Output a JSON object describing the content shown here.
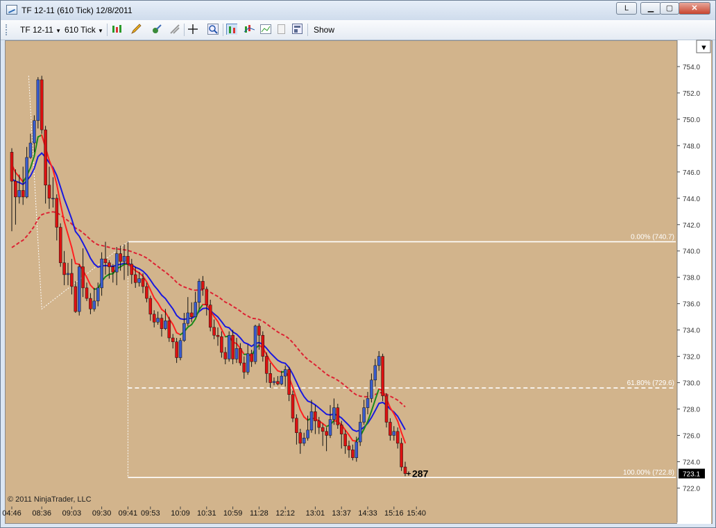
{
  "window": {
    "title": "TF 12-11 (610 Tick)  12/8/2011",
    "btn_l": "L",
    "btn_min": "▁",
    "btn_max": "▢",
    "btn_close": "✕"
  },
  "toolbar": {
    "instrument": "TF 12-11",
    "interval": "610 Tick",
    "show_label": "Show"
  },
  "copyright": "© 2011 NinjaTrader, LLC",
  "colors": {
    "background": "#d2b48c",
    "up_candle": "#3a5ccc",
    "down_candle": "#dd1111",
    "ma_fast": "#ff2020",
    "ma_fast_alt": "#1a8a1a",
    "ma_mid": "#1818e0",
    "ma_slow": "#dd2233",
    "fib": "#ffffff"
  },
  "chart_data": {
    "type": "candlestick",
    "y_range": [
      721,
      755
    ],
    "y_ticks": [
      "754.0",
      "752.0",
      "750.0",
      "748.0",
      "746.0",
      "744.0",
      "742.0",
      "740.0",
      "738.0",
      "736.0",
      "734.0",
      "732.0",
      "730.0",
      "728.0",
      "726.0",
      "724.0",
      "722.0"
    ],
    "x_ticks": [
      "04:46",
      "08:36",
      "09:03",
      "09:30",
      "09:41",
      "09:53",
      "10:09",
      "10:31",
      "10:59",
      "11:28",
      "12:12",
      "13:01",
      "13:37",
      "14:33",
      "15:16",
      "15:40"
    ],
    "x_tick_bar_index": [
      0,
      8,
      16,
      24,
      31,
      37,
      45,
      52,
      59,
      66,
      73,
      81,
      88,
      95,
      102,
      108
    ],
    "last_price_label": "723.1",
    "last_price": 723.1,
    "bar_counter": "287",
    "fibonacci": [
      {
        "label": "0.00% (740.7)",
        "value": 740.7
      },
      {
        "label": "61.80% (729.6)",
        "value": 729.6
      },
      {
        "label": "100.00% (722.8)",
        "value": 722.8
      }
    ],
    "candles": [
      [
        747.5,
        745.3,
        747.8,
        741.5
      ],
      [
        745.3,
        744.1,
        746.2,
        742.0
      ],
      [
        744.1,
        744.6,
        745.8,
        743.6
      ],
      [
        744.6,
        744.1,
        746.4,
        743.5
      ],
      [
        744.1,
        747.1,
        747.9,
        744.0
      ],
      [
        747.1,
        748.2,
        748.9,
        747.0
      ],
      [
        748.2,
        749.9,
        750.3,
        747.5
      ],
      [
        749.9,
        753.0,
        753.2,
        749.3
      ],
      [
        753.0,
        749.2,
        753.3,
        748.9
      ],
      [
        749.2,
        745.0,
        749.5,
        743.6
      ],
      [
        745.0,
        744.0,
        746.4,
        743.2
      ],
      [
        744.0,
        744.0,
        745.6,
        743.3
      ],
      [
        744.0,
        741.8,
        744.3,
        740.8
      ],
      [
        741.8,
        739.1,
        742.1,
        738.8
      ],
      [
        739.1,
        738.2,
        740.0,
        737.4
      ],
      [
        738.2,
        738.3,
        739.1,
        737.4
      ],
      [
        738.3,
        737.3,
        739.4,
        736.7
      ],
      [
        737.3,
        735.4,
        737.7,
        735.3
      ],
      [
        735.4,
        738.8,
        739.0,
        735.1
      ],
      [
        738.8,
        737.2,
        740.2,
        736.5
      ],
      [
        737.2,
        736.4,
        737.6,
        736.2
      ],
      [
        736.4,
        735.6,
        736.8,
        735.2
      ],
      [
        735.6,
        736.2,
        737.2,
        735.4
      ],
      [
        736.2,
        737.2,
        737.6,
        735.8
      ],
      [
        737.2,
        739.4,
        739.9,
        736.6
      ],
      [
        739.4,
        739.1,
        740.7,
        738.2
      ],
      [
        739.1,
        738.8,
        739.3,
        737.9
      ],
      [
        738.8,
        738.4,
        739.0,
        737.6
      ],
      [
        738.4,
        739.8,
        740.3,
        737.4
      ],
      [
        739.8,
        739.2,
        740.4,
        738.5
      ],
      [
        739.2,
        739.6,
        740.5,
        737.8
      ],
      [
        739.6,
        739.0,
        740.7,
        738.1
      ],
      [
        739.0,
        738.2,
        739.4,
        737.5
      ],
      [
        738.2,
        737.6,
        738.8,
        737.2
      ],
      [
        737.6,
        737.9,
        738.4,
        737.3
      ],
      [
        737.9,
        737.3,
        738.3,
        736.8
      ],
      [
        737.3,
        736.4,
        737.6,
        736.1
      ],
      [
        736.4,
        735.2,
        736.6,
        734.7
      ],
      [
        735.2,
        734.6,
        735.5,
        734.2
      ],
      [
        734.6,
        734.9,
        735.4,
        734.4
      ],
      [
        734.9,
        734.1,
        735.2,
        733.5
      ],
      [
        734.1,
        734.7,
        735.6,
        734.0
      ],
      [
        734.7,
        733.4,
        735.0,
        733.1
      ],
      [
        733.4,
        733.1,
        733.7,
        732.6
      ],
      [
        733.1,
        731.9,
        733.4,
        731.5
      ],
      [
        731.9,
        733.2,
        733.4,
        731.7
      ],
      [
        733.2,
        734.5,
        735.3,
        733.1
      ],
      [
        734.5,
        735.3,
        736.5,
        734.3
      ],
      [
        735.3,
        735.0,
        736.1,
        734.6
      ],
      [
        735.0,
        736.1,
        736.9,
        735.0
      ],
      [
        736.1,
        737.7,
        737.9,
        735.6
      ],
      [
        737.7,
        737.1,
        738.1,
        736.6
      ],
      [
        737.1,
        735.9,
        737.3,
        735.1
      ],
      [
        735.9,
        734.2,
        736.3,
        733.9
      ],
      [
        734.2,
        733.6,
        734.8,
        733.3
      ],
      [
        733.6,
        733.5,
        734.2,
        732.8
      ],
      [
        733.5,
        732.3,
        733.9,
        731.9
      ],
      [
        732.3,
        731.8,
        732.7,
        731.4
      ],
      [
        731.8,
        733.6,
        733.9,
        731.6
      ],
      [
        733.6,
        731.8,
        734.0,
        731.4
      ],
      [
        731.8,
        732.6,
        733.4,
        731.5
      ],
      [
        732.6,
        731.5,
        733.0,
        731.3
      ],
      [
        731.5,
        730.8,
        732.0,
        730.3
      ],
      [
        730.8,
        732.2,
        732.9,
        730.6
      ],
      [
        732.2,
        731.6,
        732.5,
        731.2
      ],
      [
        731.6,
        734.3,
        734.4,
        731.4
      ],
      [
        734.3,
        733.6,
        734.5,
        732.5
      ],
      [
        733.6,
        732.0,
        733.9,
        731.6
      ],
      [
        732.0,
        730.7,
        732.3,
        730.0
      ],
      [
        730.7,
        730.0,
        731.5,
        729.6
      ],
      [
        730.0,
        730.1,
        730.4,
        729.8
      ],
      [
        730.1,
        729.9,
        730.5,
        729.8
      ],
      [
        729.9,
        730.5,
        730.9,
        729.8
      ],
      [
        730.5,
        731.0,
        731.3,
        729.7
      ],
      [
        731.0,
        729.1,
        731.2,
        728.6
      ],
      [
        729.1,
        727.3,
        729.4,
        727.0
      ],
      [
        727.3,
        726.2,
        727.6,
        725.3
      ],
      [
        726.2,
        725.4,
        726.5,
        724.6
      ],
      [
        725.4,
        725.8,
        726.2,
        725.2
      ],
      [
        725.8,
        726.4,
        727.5,
        725.6
      ],
      [
        726.4,
        727.8,
        728.7,
        726.2
      ],
      [
        727.8,
        727.1,
        728.3,
        726.1
      ],
      [
        727.1,
        726.6,
        727.4,
        726.1
      ],
      [
        726.6,
        726.3,
        726.9,
        725.2
      ],
      [
        726.3,
        726.0,
        726.6,
        724.8
      ],
      [
        726.0,
        727.2,
        728.3,
        725.8
      ],
      [
        727.2,
        728.1,
        728.8,
        726.8
      ],
      [
        728.1,
        726.8,
        728.4,
        726.5
      ],
      [
        726.8,
        726.1,
        727.1,
        725.0
      ],
      [
        726.1,
        725.2,
        726.4,
        724.6
      ],
      [
        725.2,
        724.9,
        725.6,
        724.3
      ],
      [
        724.9,
        724.3,
        725.3,
        724.1
      ],
      [
        724.3,
        725.5,
        725.9,
        724.0
      ],
      [
        725.5,
        727.0,
        727.6,
        725.2
      ],
      [
        727.0,
        728.1,
        728.7,
        726.8
      ],
      [
        728.1,
        728.8,
        729.3,
        727.6
      ],
      [
        728.8,
        730.2,
        730.7,
        728.5
      ],
      [
        730.2,
        731.3,
        731.8,
        729.7
      ],
      [
        731.3,
        732.0,
        732.4,
        730.9
      ],
      [
        732.0,
        729.0,
        732.2,
        728.6
      ],
      [
        729.0,
        727.0,
        729.2,
        726.6
      ],
      [
        727.0,
        726.0,
        727.3,
        725.6
      ],
      [
        726.0,
        726.3,
        726.7,
        725.6
      ],
      [
        726.3,
        725.4,
        726.6,
        725.0
      ],
      [
        725.4,
        723.6,
        725.8,
        723.3
      ],
      [
        723.6,
        723.1,
        724.0,
        722.9
      ]
    ]
  }
}
